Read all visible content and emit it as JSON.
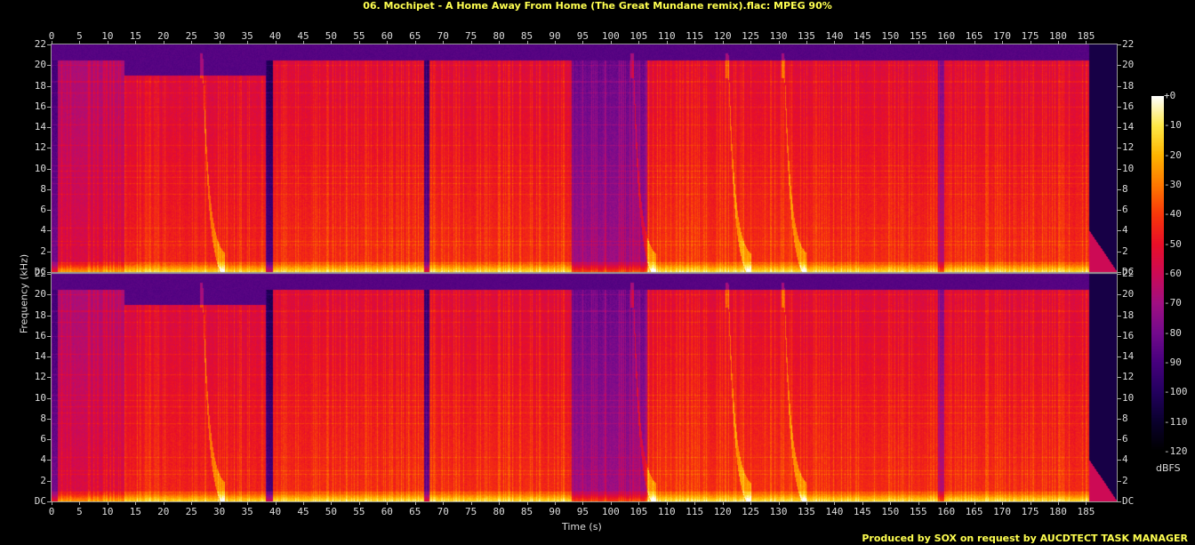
{
  "title": "06. Mochipet - A Home Away From Home (The Great Mundane remix).flac: MPEG 90%",
  "credit": "Produced by SOX on request by AUCDTECT TASK MANAGER",
  "chart_data": {
    "type": "heatmap",
    "subtype": "spectrogram",
    "channels": 2,
    "xlabel": "Time (s)",
    "ylabel": "Frequency (kHz)",
    "xlim": [
      0,
      190.5
    ],
    "ylim": [
      0,
      22
    ],
    "x_ticks": [
      0,
      5,
      10,
      15,
      20,
      25,
      30,
      35,
      40,
      45,
      50,
      55,
      60,
      65,
      70,
      75,
      80,
      85,
      90,
      95,
      100,
      105,
      110,
      115,
      120,
      125,
      130,
      135,
      140,
      145,
      150,
      155,
      160,
      165,
      170,
      175,
      180,
      185
    ],
    "y_ticks": [
      "DC",
      "2",
      "4",
      "6",
      "8",
      "10",
      "12",
      "14",
      "16",
      "18",
      "20",
      "22"
    ],
    "colorbar": {
      "label": "dBFS",
      "range": [
        -120,
        0
      ],
      "ticks": [
        "+0",
        "-10",
        "-20",
        "-30",
        "-40",
        "-50",
        "-60",
        "-70",
        "-80",
        "-90",
        "-100",
        "-110",
        "-120"
      ]
    },
    "segments_dbfs": [
      {
        "start": 0,
        "end": 1,
        "level": -85,
        "cutoff_khz": 20.5
      },
      {
        "start": 1,
        "end": 13,
        "level": -60,
        "cutoff_khz": 20.5
      },
      {
        "start": 13,
        "end": 38.3,
        "level": -50,
        "cutoff_khz": 19
      },
      {
        "start": 38.3,
        "end": 39.5,
        "level": -95,
        "cutoff_khz": 20.5
      },
      {
        "start": 39.5,
        "end": 66.5,
        "level": -48,
        "cutoff_khz": 20.5
      },
      {
        "start": 66.5,
        "end": 67.5,
        "level": -90,
        "cutoff_khz": 20.5
      },
      {
        "start": 67.5,
        "end": 93,
        "level": -48,
        "cutoff_khz": 20.5
      },
      {
        "start": 93,
        "end": 106.5,
        "level": -75,
        "cutoff_khz": 20.5
      },
      {
        "start": 106.5,
        "end": 133,
        "level": -47,
        "cutoff_khz": 20.5
      },
      {
        "start": 133,
        "end": 158.5,
        "level": -48,
        "cutoff_khz": 20.5
      },
      {
        "start": 158.5,
        "end": 159.5,
        "level": -70,
        "cutoff_khz": 20.5
      },
      {
        "start": 159.5,
        "end": 185.5,
        "level": -48,
        "cutoff_khz": 20.5
      },
      {
        "start": 185.5,
        "end": 190.5,
        "level": -105,
        "cutoff_khz": 2
      }
    ],
    "sweeps_s": [
      27,
      104,
      121,
      131
    ]
  }
}
